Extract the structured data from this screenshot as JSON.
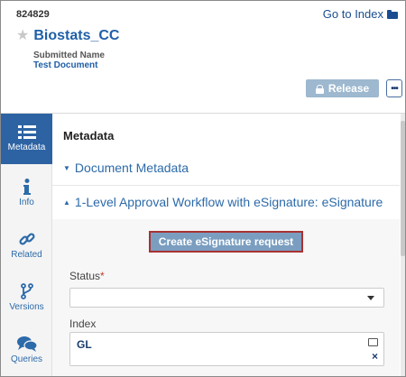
{
  "header": {
    "doc_number": "824829",
    "goto_index_label": "Go to Index",
    "title": "Biostats_CC",
    "submitted_name_label": "Submitted Name",
    "submitted_name_value": "Test Document",
    "release_label": "Release",
    "more_label": "•••"
  },
  "nav": {
    "items": [
      {
        "label": "Metadata",
        "icon": "list-icon",
        "active": true
      },
      {
        "label": "Info",
        "icon": "info-icon",
        "active": false
      },
      {
        "label": "Related",
        "icon": "link-icon",
        "active": false
      },
      {
        "label": "Versions",
        "icon": "branch-icon",
        "active": false
      },
      {
        "label": "Queries",
        "icon": "chat-icon",
        "active": false
      }
    ]
  },
  "main": {
    "title": "Metadata",
    "sections": [
      {
        "label": "Document Metadata",
        "expanded": false
      },
      {
        "label": "1-Level Approval Workflow with eSignature: eSignature",
        "expanded": true
      }
    ],
    "esig_button_label": "Create eSignature request",
    "status": {
      "label": "Status",
      "required_mark": "*",
      "value": ""
    },
    "index": {
      "label": "Index",
      "value": "GL",
      "clear_label": "×"
    }
  },
  "colors": {
    "accent": "#2d63a3",
    "link": "#2c6aa9",
    "release_button": "#9db8cf",
    "esig_button": "#7b9ec0",
    "esig_border": "#a83232"
  }
}
